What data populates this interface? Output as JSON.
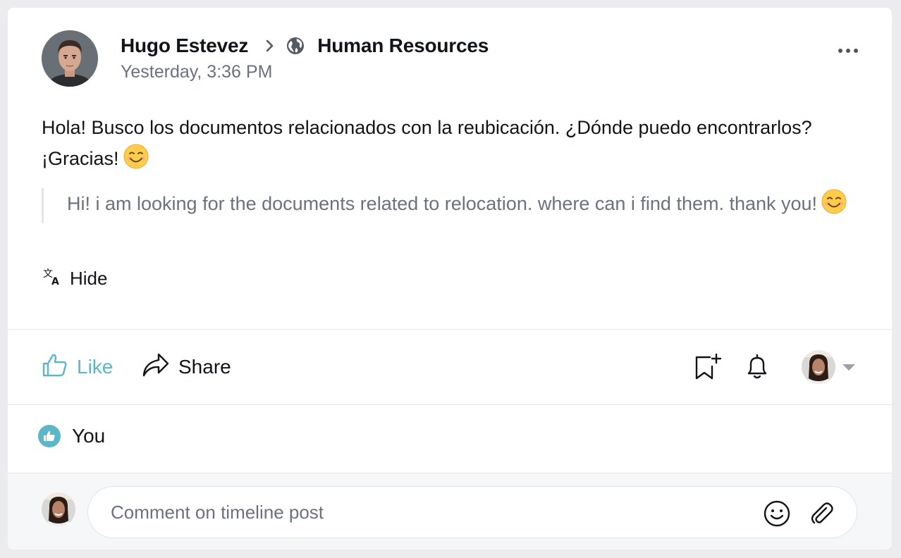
{
  "post": {
    "author": "Hugo Estevez",
    "group": "Human Resources",
    "timestamp": "Yesterday, 3:36 PM",
    "text": "Hola! Busco los documentos relacionados con la reubicación. ¿Dónde puedo encontrarlos? ¡Gracias!",
    "emoji": "smiling-face-icon",
    "translation": "Hi! i am looking for the documents related to relocation. where can i find them. thank you!",
    "hide_label": "Hide"
  },
  "actions": {
    "like_label": "Like",
    "share_label": "Share",
    "like_color": "#5bb7c8"
  },
  "likes": {
    "label": "You"
  },
  "comment": {
    "placeholder": "Comment on timeline post"
  },
  "icons": {
    "chevron": "chevron-right-icon",
    "globe": "globe-icon",
    "more": "more-options-icon",
    "translate": "translate-icon",
    "like": "thumbs-up-icon",
    "share": "share-icon",
    "bookmark": "bookmark-add-icon",
    "bell": "bell-icon",
    "emoji": "emoji-icon",
    "attach": "paperclip-icon"
  }
}
